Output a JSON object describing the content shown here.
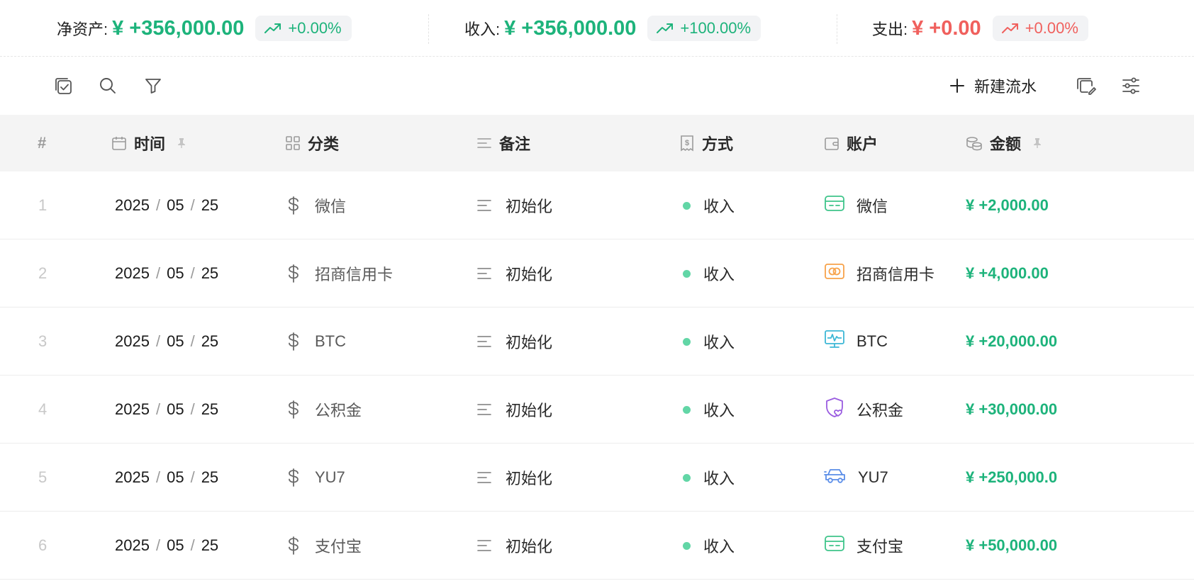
{
  "summary": {
    "net": {
      "label": "净资产:",
      "value": "¥ +356,000.00",
      "change": "+0.00%"
    },
    "income": {
      "label": "收入:",
      "value": "¥ +356,000.00",
      "change": "+100.00%"
    },
    "expense": {
      "label": "支出:",
      "value": "¥ +0.00",
      "change": "+0.00%"
    }
  },
  "toolbar": {
    "new_label": "新建流水",
    "left_icons": [
      "batch-select-icon",
      "search-icon",
      "filter-icon"
    ],
    "right_icons": [
      "copy-edit-icon",
      "settings-sliders-icon"
    ]
  },
  "colors": {
    "positive": "#1db37b",
    "negative": "#f0605d",
    "header_bg": "#f4f4f4",
    "income_dot": "#62d6a6"
  },
  "table": {
    "columns": {
      "index": "#",
      "time": "时间",
      "category": "分类",
      "note": "备注",
      "method": "方式",
      "account": "账户",
      "amount": "金额"
    },
    "rows": [
      {
        "index": "1",
        "year": "2025",
        "month": "05",
        "day": "25",
        "category": "微信",
        "note": "初始化",
        "method": "收入",
        "account": "微信",
        "account_icon": "wallet-card-icon",
        "amount": "¥ +2,000.00"
      },
      {
        "index": "2",
        "year": "2025",
        "month": "05",
        "day": "25",
        "category": "招商信用卡",
        "note": "初始化",
        "method": "收入",
        "account": "招商信用卡",
        "account_icon": "credit-card-icon",
        "amount": "¥ +4,000.00"
      },
      {
        "index": "3",
        "year": "2025",
        "month": "05",
        "day": "25",
        "category": "BTC",
        "note": "初始化",
        "method": "收入",
        "account": "BTC",
        "account_icon": "monitor-icon",
        "amount": "¥ +20,000.00"
      },
      {
        "index": "4",
        "year": "2025",
        "month": "05",
        "day": "25",
        "category": "公积金",
        "note": "初始化",
        "method": "收入",
        "account": "公积金",
        "account_icon": "shield-heart-icon",
        "amount": "¥ +30,000.00"
      },
      {
        "index": "5",
        "year": "2025",
        "month": "05",
        "day": "25",
        "category": "YU7",
        "note": "初始化",
        "method": "收入",
        "account": "YU7",
        "account_icon": "car-icon",
        "amount": "¥ +250,000.0"
      },
      {
        "index": "6",
        "year": "2025",
        "month": "05",
        "day": "25",
        "category": "支付宝",
        "note": "初始化",
        "method": "收入",
        "account": "支付宝",
        "account_icon": "wallet-card-icon",
        "amount": "¥ +50,000.00"
      }
    ]
  }
}
